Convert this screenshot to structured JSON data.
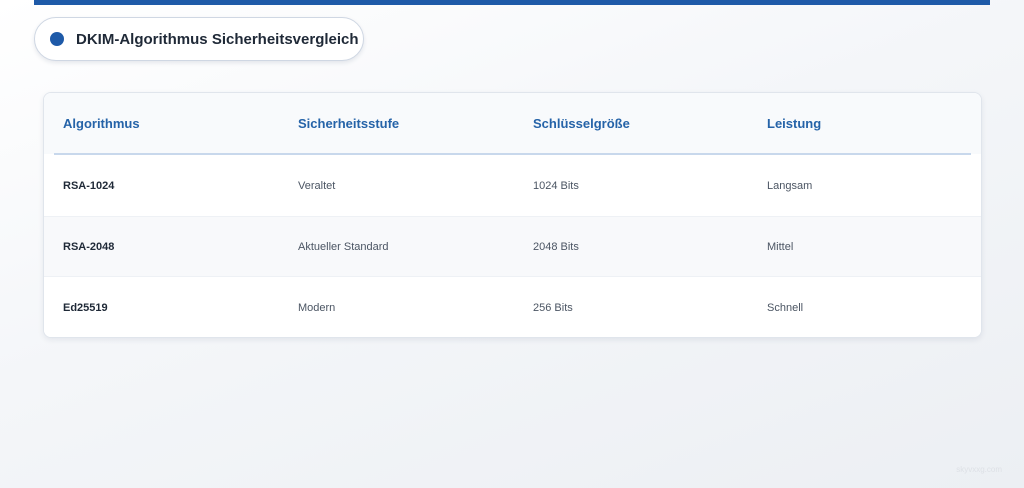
{
  "header": {
    "title": "DKIM-Algorithmus Sicherheitsvergleich",
    "accent_color": "#1e5aa8"
  },
  "table": {
    "columns": [
      "Algorithmus",
      "Sicherheitsstufe",
      "Schlüsselgröße",
      "Leistung"
    ],
    "rows": [
      [
        "RSA-1024",
        "Veraltet",
        "1024 Bits",
        "Langsam"
      ],
      [
        "RSA-2048",
        "Aktueller Standard",
        "2048 Bits",
        "Mittel"
      ],
      [
        "Ed25519",
        "Modern",
        "256 Bits",
        "Schnell"
      ]
    ]
  },
  "footer": {
    "watermark": "skyvxxg.com"
  }
}
